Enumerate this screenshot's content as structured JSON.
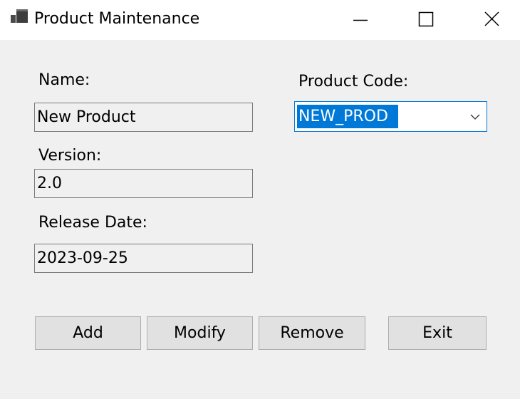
{
  "window": {
    "title": "Product Maintenance",
    "app_icon": "app-window-icon",
    "controls": {
      "minimize_icon": "minimize-icon",
      "maximize_icon": "maximize-icon",
      "close_icon": "close-icon"
    }
  },
  "form": {
    "name": {
      "label": "Name:",
      "value": "New Product"
    },
    "product_code": {
      "label": "Product Code:",
      "value": "NEW_PROD",
      "dropdown_icon": "chevron-down-icon"
    },
    "version": {
      "label": "Version:",
      "value": "2.0"
    },
    "release_date": {
      "label": "Release Date:",
      "value": "2023-09-25"
    }
  },
  "buttons": {
    "add": "Add",
    "modify": "Modify",
    "remove": "Remove",
    "exit": "Exit"
  },
  "colors": {
    "window_background": "#f0f0f0",
    "titlebar_background": "#ffffff",
    "selection_highlight": "#0078d7",
    "button_face": "#e1e1e1",
    "button_border": "#adadad"
  }
}
